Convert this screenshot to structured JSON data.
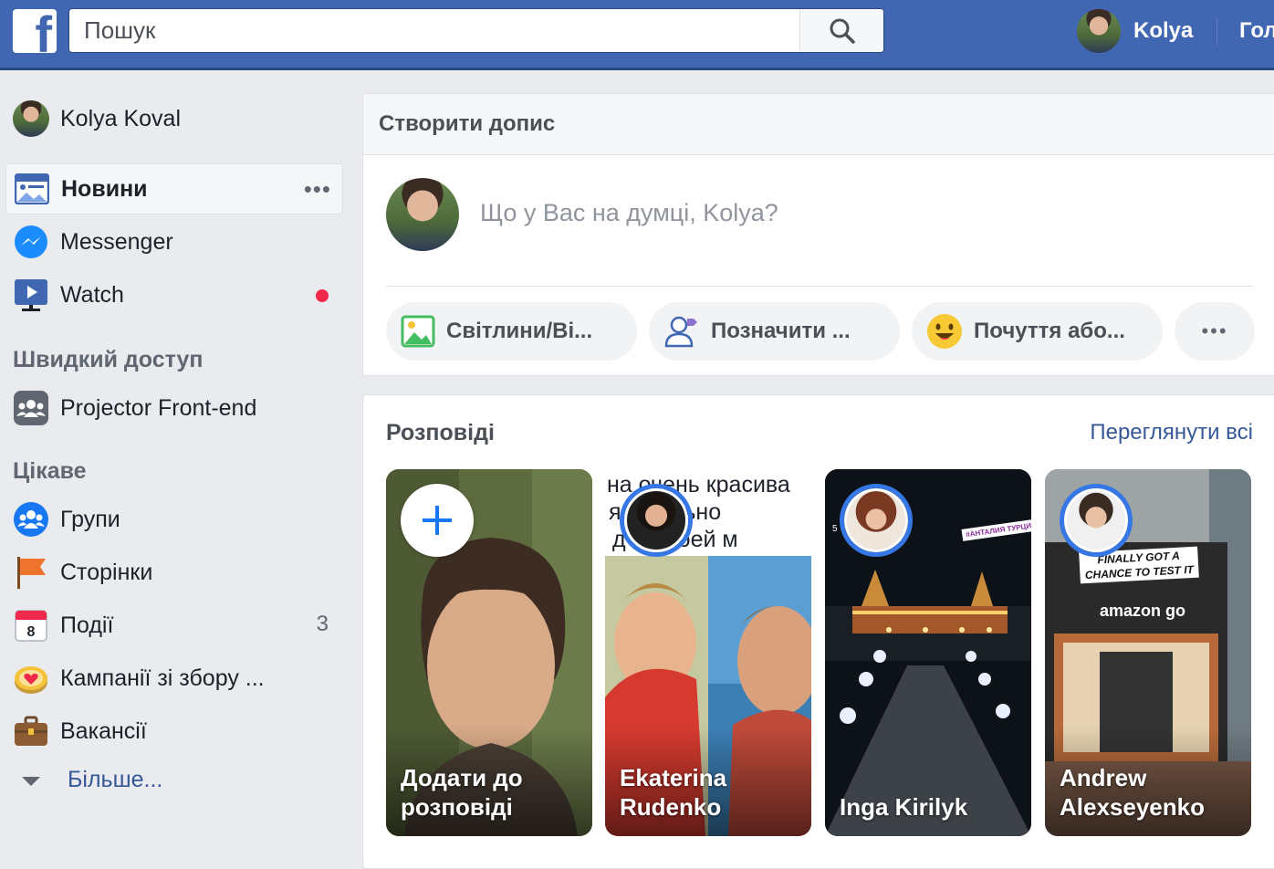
{
  "header": {
    "logo": "f",
    "search_placeholder": "Пошук",
    "user_name": "Kolya",
    "home_label": "Голов"
  },
  "sidebar": {
    "user_name": "Kolya Koval",
    "main_items": [
      {
        "label": "Новини",
        "icon": "news-feed-icon",
        "active": true
      },
      {
        "label": "Messenger",
        "icon": "messenger-icon"
      },
      {
        "label": "Watch",
        "icon": "watch-icon",
        "notification_dot": true
      }
    ],
    "quick_access_heading": "Швидкий доступ",
    "quick_access": [
      {
        "label": "Projector Front-end",
        "icon": "group-icon"
      }
    ],
    "explore_heading": "Цікаве",
    "explore": [
      {
        "label": "Групи",
        "icon": "groups-icon"
      },
      {
        "label": "Сторінки",
        "icon": "pages-flag-icon"
      },
      {
        "label": "Події",
        "icon": "calendar-icon",
        "count": "3",
        "calendar_day": "8"
      },
      {
        "label": "Кампанії зі збору ...",
        "icon": "fundraiser-icon"
      },
      {
        "label": "Вакансії",
        "icon": "jobs-briefcase-icon"
      }
    ],
    "more_label": "Більше..."
  },
  "composer": {
    "title": "Створити допис",
    "prompt": "Що у Вас на думці, Kolya?",
    "actions": [
      {
        "label": "Світлини/Ві...",
        "icon": "photo-icon"
      },
      {
        "label": "Позначити ...",
        "icon": "tag-friends-icon"
      },
      {
        "label": "Почуття або...",
        "icon": "feeling-emoji-icon"
      }
    ],
    "more_label": "•••"
  },
  "stories": {
    "title": "Розповіді",
    "see_all": "Переглянути всі",
    "items": [
      {
        "caption": "Додати до розповіді",
        "add": true
      },
      {
        "caption": "Ekaterina Rudenko",
        "overlay_text": [
          "на очень красива",
          "я.а сильно",
          "д ю твоей м"
        ]
      },
      {
        "caption": "Inga Kirilyk",
        "sticker": "#АНТАЛИЯ ТУРЦИЯ",
        "edge_digit": "5"
      },
      {
        "caption": "Andrew Alexseyenko",
        "sign_text": "FINALLY GOT A CHANCE TO TEST IT",
        "store_logo": "amazon go"
      }
    ]
  },
  "colors": {
    "brand_blue": "#4267b2",
    "link_blue": "#365899",
    "story_ring": "#3578e5",
    "notification_red": "#f02849"
  }
}
